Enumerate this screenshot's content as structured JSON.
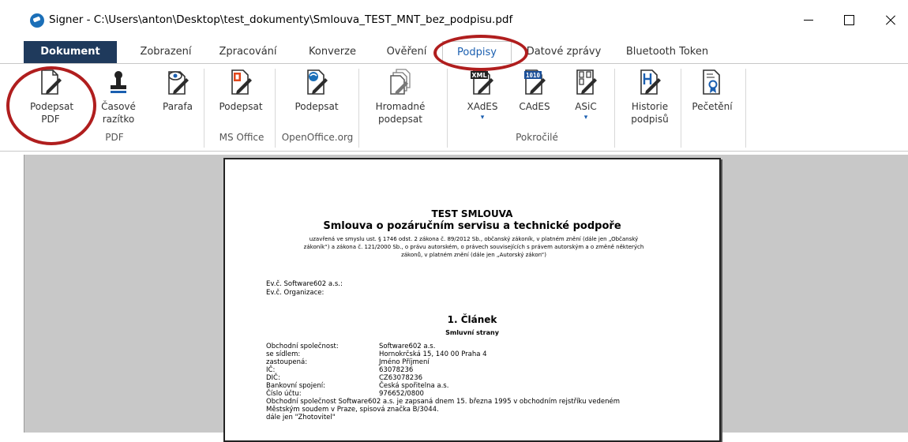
{
  "window": {
    "title": "Signer - C:\\Users\\anton\\Desktop\\test_dokumenty\\Smlouva_TEST_MNT_bez_podpisu.pdf"
  },
  "tabs": [
    {
      "label": "Dokument"
    },
    {
      "label": "Zobrazení"
    },
    {
      "label": "Zpracování"
    },
    {
      "label": "Konverze"
    },
    {
      "label": "Ověření"
    },
    {
      "label": "Podpisy"
    },
    {
      "label": "Datové zprávy"
    },
    {
      "label": "Bluetooth Token"
    }
  ],
  "ribbon": {
    "pdf": {
      "sign_line1": "Podepsat",
      "sign_line2": "PDF",
      "timestamp_line1": "Časové",
      "timestamp_line2": "razítko",
      "parafa": "Parafa",
      "group": "PDF"
    },
    "msoffice": {
      "sign": "Podepsat",
      "group": "MS Office"
    },
    "openoffice": {
      "sign": "Podepsat",
      "group": "OpenOffice.org"
    },
    "batch": {
      "line1": "Hromadné",
      "line2": "podepsat"
    },
    "advanced": {
      "xades": "XAdES",
      "cades": "CAdES",
      "asic": "ASiC",
      "group": "Pokročilé",
      "xml_badge": "XML",
      "bin_badge": "1010"
    },
    "history": {
      "line1": "Historie",
      "line2": "podpisů"
    },
    "seal": {
      "label": "Pečetění"
    }
  },
  "document": {
    "title": "TEST SMLOUVA",
    "subtitle": "Smlouva o pozáručním servisu a technické podpoře",
    "intro_line1": "uzavřená ve smyslu ust. § 1746 odst. 2 zákona č. 89/2012 Sb., občanský zákoník, v platném znění (dále jen „Občanský",
    "intro_line2": "zákoník“) a zákona č. 121/2000 Sb., o právu autorském, o právech souvisejících s právem autorským a o změně některých",
    "intro_line3": "zákonů, v platném znění (dále jen „Autorský zákon“)",
    "ev_software": "Ev.č. Software602 a.s.:",
    "ev_org": "Ev.č. Organizace:",
    "clanek": "1.  Článek",
    "strany": "Smluvní strany",
    "fields": [
      {
        "label": "Obchodní společnost:",
        "value": "Software602 a.s."
      },
      {
        "label": "se sídlem:",
        "value": "Hornokrčská 15, 140 00 Praha 4"
      },
      {
        "label": "zastoupená:",
        "value": "Jméno Příjmení"
      },
      {
        "label": "IČ:",
        "value": "63078236"
      },
      {
        "label": "DIČ:",
        "value": "CZ63078236"
      },
      {
        "label": "Bankovní spojení:",
        "value": "Česká spořitelna a.s."
      },
      {
        "label": "Číslo účtu:",
        "value": "976652/0800"
      }
    ],
    "para_line1": "Obchodní společnost Software602 a.s. je zapsaná dnem 15. března 1995 v obchodním rejstříku vedeném",
    "para_line2": "Městským soudem v Praze, spisová značka B/3044.",
    "para_line3": "dále jen \"Zhotovitel\""
  },
  "colors": {
    "accent": "#1b5fb0",
    "doc_tab": "#1f3a5c",
    "highlight": "#b01e1e",
    "workspace": "#c8c8c8"
  }
}
